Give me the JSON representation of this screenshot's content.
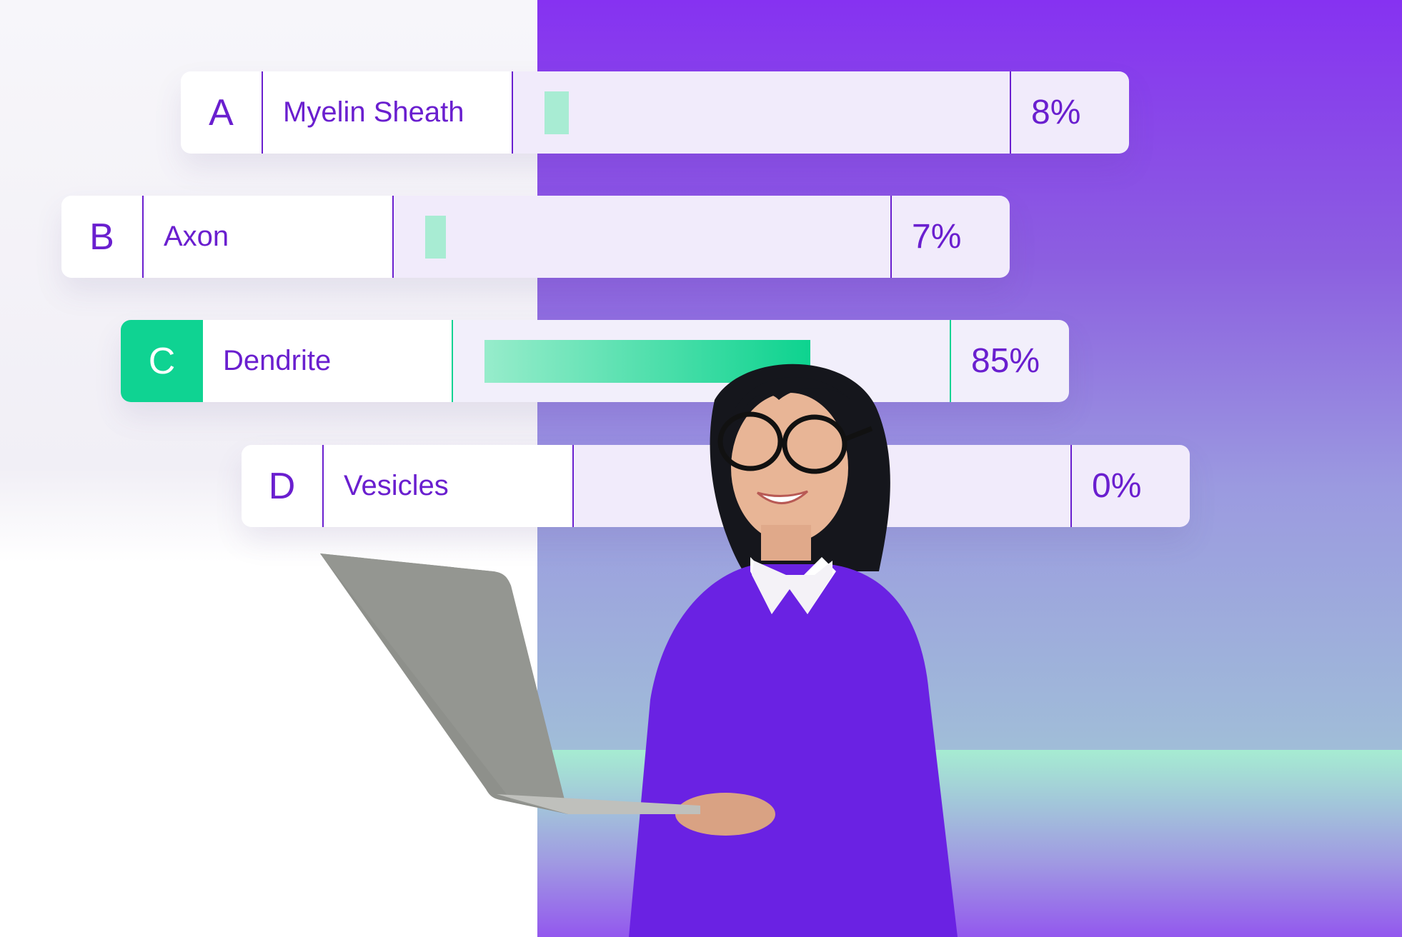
{
  "quiz": {
    "options": [
      {
        "letter": "A",
        "label": "Myelin Sheath",
        "percent_text": "8%",
        "value": 8,
        "selected": false
      },
      {
        "letter": "B",
        "label": "Axon",
        "percent_text": "7%",
        "value": 7,
        "selected": false
      },
      {
        "letter": "C",
        "label": "Dendrite",
        "percent_text": "85%",
        "value": 85,
        "selected": true
      },
      {
        "letter": "D",
        "label": "Vesicles",
        "percent_text": "0%",
        "value": 0,
        "selected": false
      }
    ]
  },
  "colors": {
    "primary_purple": "#6a1fcf",
    "accent_green": "#0fd392",
    "bar_light_green": "#a8ecd3",
    "bg_purple": "#8632f1",
    "track_lavender": "#f1ebfb"
  },
  "illustration": {
    "subject": "smiling woman with glasses in purple sweater holding laptop"
  }
}
